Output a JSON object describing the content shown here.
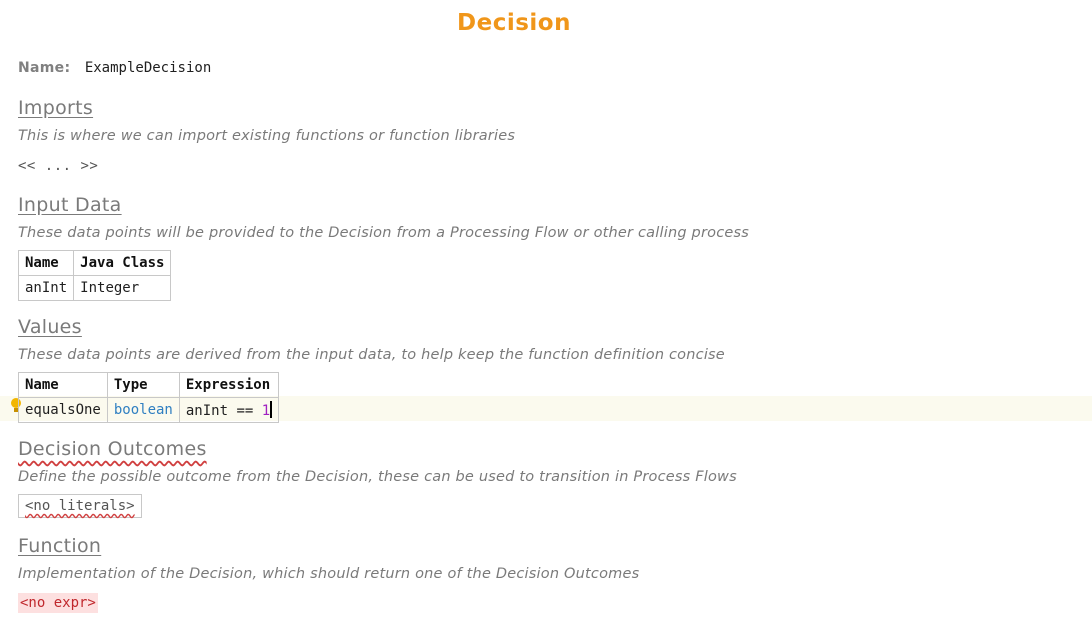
{
  "title": "Decision",
  "name_label": "Name:",
  "name_value": "ExampleDecision",
  "imports": {
    "heading": "Imports",
    "description": "This is where we can import existing functions or function libraries",
    "placeholder": "<< ... >>"
  },
  "input_data": {
    "heading": "Input Data",
    "description": "These data points will be provided to the Decision from a Processing Flow or other calling process",
    "columns": [
      "Name",
      "Java Class"
    ],
    "rows": [
      [
        "anInt",
        "Integer"
      ]
    ]
  },
  "values": {
    "heading": "Values",
    "description": "These data points are derived from the input data, to help keep the function definition concise",
    "columns": [
      "Name",
      "Type",
      "Expression"
    ],
    "row": {
      "name": "equalsOne",
      "type": "boolean",
      "expr_prefix": "anInt == ",
      "expr_number": "1"
    }
  },
  "decision_outcomes": {
    "heading": "Decision Outcomes",
    "description": "Define the possible outcome from the Decision, these can be used to transition in Process Flows",
    "placeholder": "<no literals>"
  },
  "function": {
    "heading": "Function",
    "description": "Implementation of the Decision, which should return one of the Decision Outcomes",
    "placeholder": "<no expr>"
  },
  "colors": {
    "title": "#f0961a",
    "keyword": "#2f7fc1",
    "number": "#a020c0",
    "error": "#c0282d"
  }
}
